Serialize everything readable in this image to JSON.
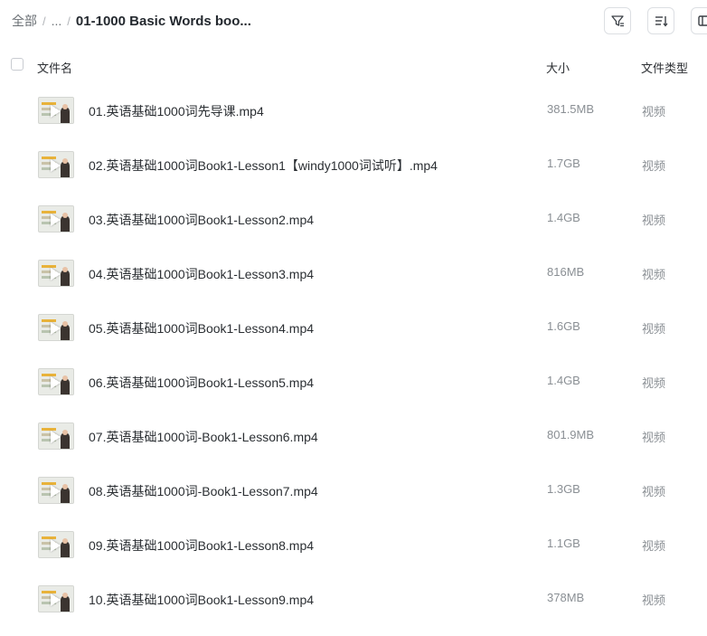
{
  "breadcrumb": {
    "root": "全部",
    "ellipsis": "...",
    "current": "01-1000 Basic Words boo..."
  },
  "toolbar": {
    "filter_icon": "filter-icon",
    "sort_icon": "sort-icon",
    "panel_icon": "panel-toggle-icon"
  },
  "table": {
    "headers": {
      "name": "文件名",
      "size": "大小",
      "type": "文件类型"
    },
    "rows": [
      {
        "name": "01.英语基础1000词先导课.mp4",
        "size": "381.5MB",
        "type": "视频"
      },
      {
        "name": "02.英语基础1000词Book1-Lesson1【windy1000词试听】.mp4",
        "size": "1.7GB",
        "type": "视频"
      },
      {
        "name": "03.英语基础1000词Book1-Lesson2.mp4",
        "size": "1.4GB",
        "type": "视频"
      },
      {
        "name": "04.英语基础1000词Book1-Lesson3.mp4",
        "size": "816MB",
        "type": "视频"
      },
      {
        "name": "05.英语基础1000词Book1-Lesson4.mp4",
        "size": "1.6GB",
        "type": "视频"
      },
      {
        "name": "06.英语基础1000词Book1-Lesson5.mp4",
        "size": "1.4GB",
        "type": "视频"
      },
      {
        "name": "07.英语基础1000词-Book1-Lesson6.mp4",
        "size": "801.9MB",
        "type": "视频"
      },
      {
        "name": "08.英语基础1000词-Book1-Lesson7.mp4",
        "size": "1.3GB",
        "type": "视频"
      },
      {
        "name": "09.英语基础1000词Book1-Lesson8.mp4",
        "size": "1.1GB",
        "type": "视频"
      },
      {
        "name": "10.英语基础1000词Book1-Lesson9.mp4",
        "size": "378MB",
        "type": "视频"
      }
    ]
  },
  "colors": {
    "accent_thumb_strip": "#e8b23a",
    "thumb_bg": "#e9ebe6"
  }
}
